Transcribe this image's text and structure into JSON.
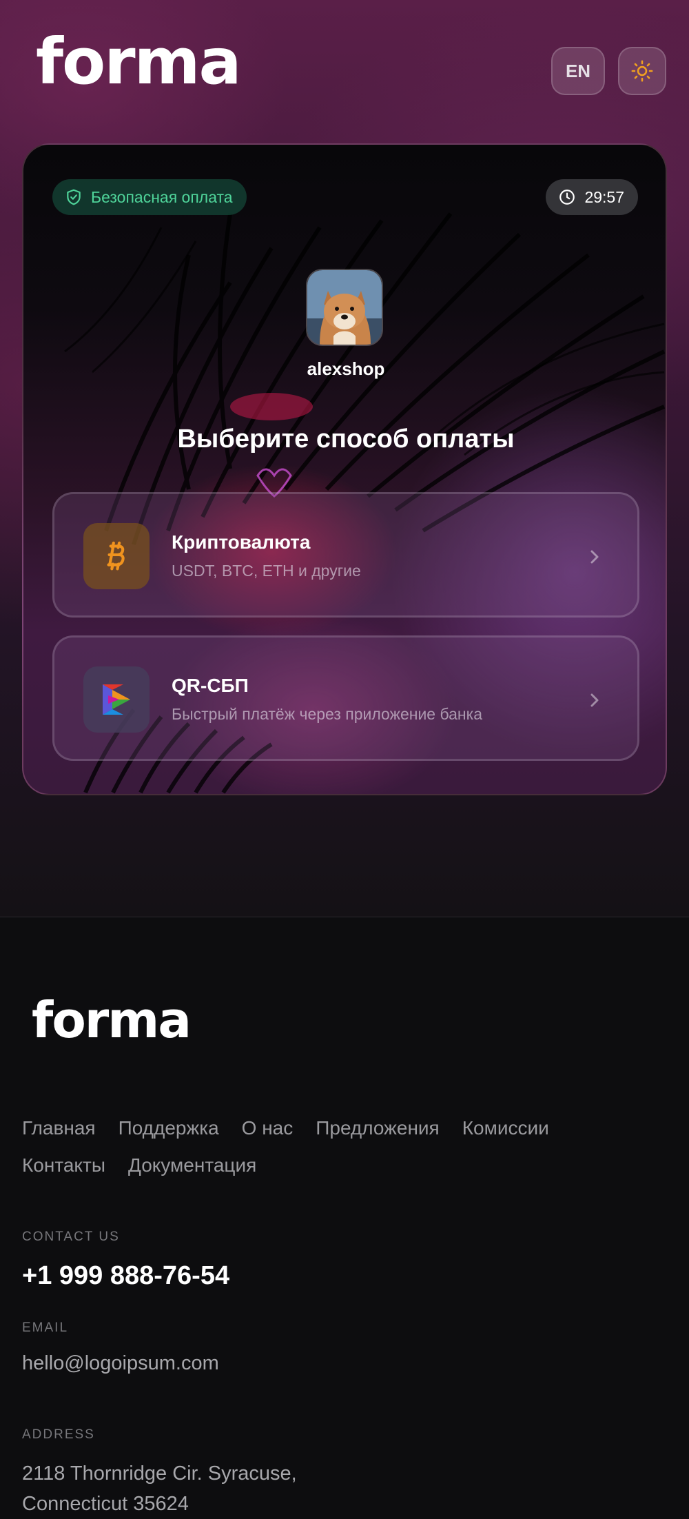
{
  "header": {
    "logo": "forma",
    "lang_label": "EN",
    "theme_icon": "sun-icon"
  },
  "payment": {
    "secure_label": "Безопасная оплата",
    "secure_icon": "shield-check-icon",
    "timer": "29:57",
    "timer_icon": "clock-icon",
    "shop_name": "alexshop",
    "title": "Выберите способ оплаты",
    "methods": [
      {
        "title": "Криптовалюта",
        "subtitle": "USDT, BTC, ETH и другие",
        "icon": "bitcoin-icon",
        "accent": "#f0931e"
      },
      {
        "title": "QR-СБП",
        "subtitle": "Быстрый платёж через приложение банка",
        "icon": "sbp-icon",
        "accent": "#7a4cff"
      }
    ]
  },
  "footer": {
    "logo": "forma",
    "nav": [
      "Главная",
      "Поддержка",
      "О нас",
      "Предложения",
      "Комиссии",
      "Контакты",
      "Документация"
    ],
    "contact_label": "CONTACT US",
    "phone": "+1 999 888-76-54",
    "email_label": "EMAIL",
    "email": "hello@logoipsum.com",
    "address_label": "ADDRESS",
    "address_line1": "2118 Thornridge Cir. Syracuse,",
    "address_line2": "Connecticut 35624"
  },
  "colors": {
    "secure_green": "#4fd49a",
    "sun_orange": "#f0a020",
    "background": "#0d0d0f"
  }
}
